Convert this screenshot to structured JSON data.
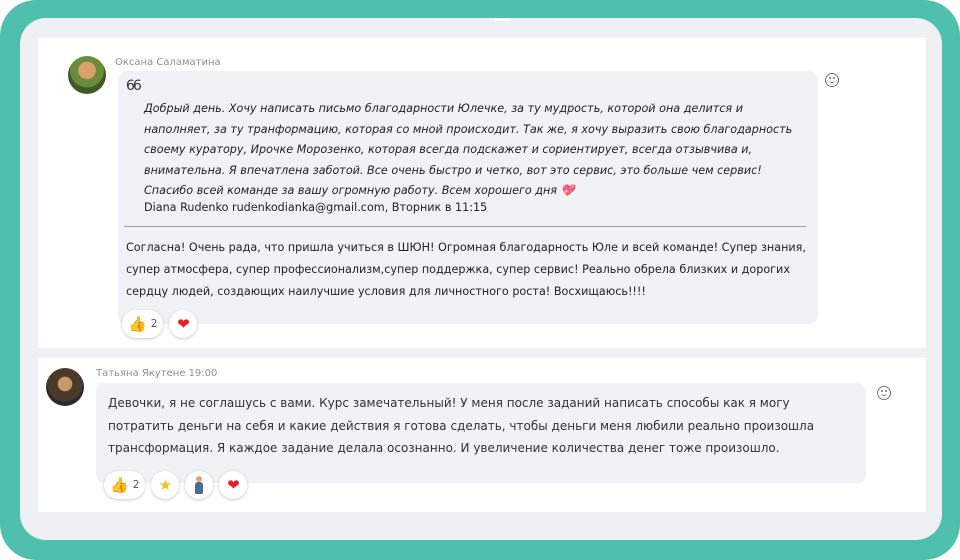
{
  "colors": {
    "frame": "#4fc0ad",
    "panel": "#eef0f3",
    "bubble": "#f0f2f5",
    "heart": "#e8202a",
    "thumb": "#f1b32c"
  },
  "comments": [
    {
      "author": "Оксана Саламатина",
      "quote_mark": "66",
      "quote_text": "Добрый день. Хочу написать письмо благодарности Юлечке, за ту мудрость, которой она делится и наполняет, за ту транформацию, которая со мной происходит. Так же, я хочу выразить свою благодарность своему куратору, Ирочке Морозенко, которая всегда подскажет и сориентирует, всегда отзывчива и, внимательна. Я впечатлена заботой. Все очень быстро и четко, вот это сервис, это больше чем сервис! Спасибо всей команде за вашу огромную работу. Всем хорошего дня 💖",
      "quote_signature": "Diana Rudenko rudenkodianka@gmail.com, Вторник в 11:15",
      "reply_text": "Согласна! Очень рада, что пришла учиться в ШЮН! Огромная благодарность Юле и всей команде! Супер знания, супер атмосфера, супер профессионализм,супер поддержка, супер сервис! Реально обрела близких и дорогих сердцу людей, создающих наилучшие условия для личностного роста! Восхищаюсь!!!!",
      "reactions": [
        {
          "icon": "thumbs-up-icon",
          "glyph": "👍",
          "count": "2"
        },
        {
          "icon": "heart-icon",
          "glyph": "❤",
          "count": ""
        }
      ]
    },
    {
      "author": "Татьяна Якутене 19:00",
      "text": "Девочки, я не соглашусь с вами. Курс замечательный! У меня после заданий написать способы как я могу потратить деньги на себя и какие действия я готова сделать, чтобы деньги меня любили реально произошла трансформация. Я каждое задание делала осознанно. И увеличение количества денег тоже произошло.",
      "reactions": [
        {
          "icon": "thumbs-up-icon",
          "glyph": "👍",
          "count": "2"
        },
        {
          "icon": "star-icon",
          "glyph": "★",
          "count": ""
        },
        {
          "icon": "person-standing-icon",
          "glyph": "",
          "count": ""
        },
        {
          "icon": "heart-icon",
          "glyph": "❤",
          "count": ""
        }
      ]
    }
  ]
}
